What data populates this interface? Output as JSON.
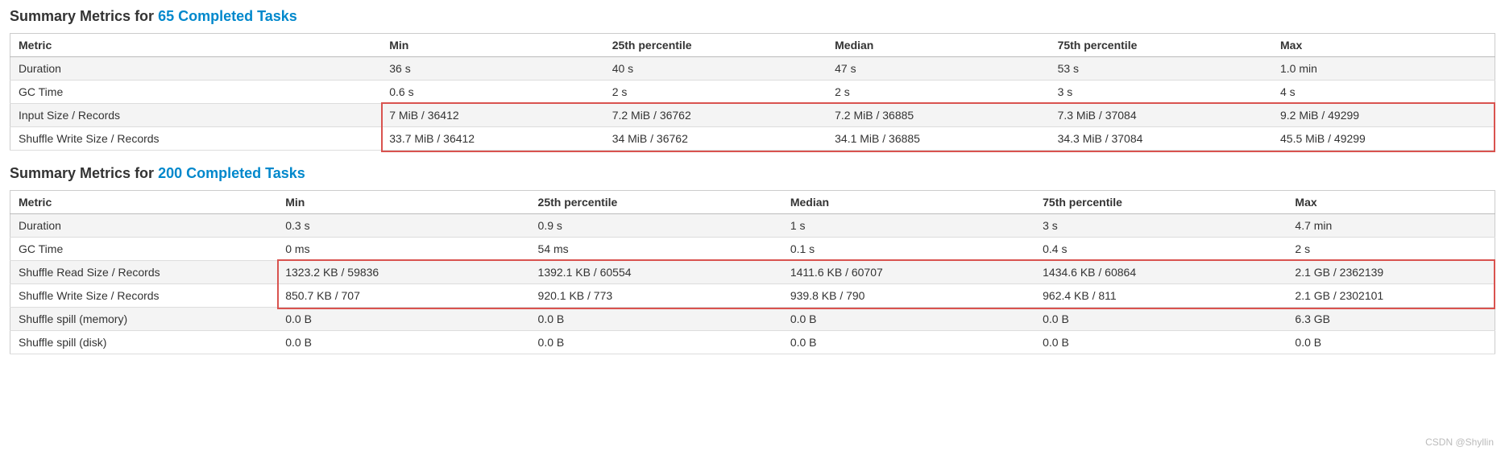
{
  "section1": {
    "title_prefix": "Summary Metrics for ",
    "task_count": "65 Completed Tasks",
    "columns": [
      "Metric",
      "Min",
      "25th percentile",
      "Median",
      "75th percentile",
      "Max"
    ],
    "rows": [
      {
        "metric": "Duration",
        "min": "36 s",
        "p25": "40 s",
        "median": "47 s",
        "p75": "53 s",
        "max": "1.0 min"
      },
      {
        "metric": "GC Time",
        "min": "0.6 s",
        "p25": "2 s",
        "median": "2 s",
        "p75": "3 s",
        "max": "4 s"
      },
      {
        "metric": "Input Size / Records",
        "min": "7 MiB / 36412",
        "p25": "7.2 MiB / 36762",
        "median": "7.2 MiB / 36885",
        "p75": "7.3 MiB / 37084",
        "max": "9.2 MiB / 49299"
      },
      {
        "metric": "Shuffle Write Size / Records",
        "min": "33.7 MiB / 36412",
        "p25": "34 MiB / 36762",
        "median": "34.1 MiB / 36885",
        "p75": "34.3 MiB / 37084",
        "max": "45.5 MiB / 49299"
      }
    ]
  },
  "section2": {
    "title_prefix": "Summary Metrics for ",
    "task_count": "200 Completed Tasks",
    "columns": [
      "Metric",
      "Min",
      "25th percentile",
      "Median",
      "75th percentile",
      "Max"
    ],
    "rows": [
      {
        "metric": "Duration",
        "min": "0.3 s",
        "p25": "0.9 s",
        "median": "1 s",
        "p75": "3 s",
        "max": "4.7 min"
      },
      {
        "metric": "GC Time",
        "min": "0 ms",
        "p25": "54 ms",
        "median": "0.1 s",
        "p75": "0.4 s",
        "max": "2 s"
      },
      {
        "metric": "Shuffle Read Size / Records",
        "min": "1323.2 KB / 59836",
        "p25": "1392.1 KB / 60554",
        "median": "1411.6 KB / 60707",
        "p75": "1434.6 KB / 60864",
        "max": "2.1 GB / 2362139"
      },
      {
        "metric": "Shuffle Write Size / Records",
        "min": "850.7 KB / 707",
        "p25": "920.1 KB / 773",
        "median": "939.8 KB / 790",
        "p75": "962.4 KB / 811",
        "max": "2.1 GB / 2302101"
      },
      {
        "metric": "Shuffle spill (memory)",
        "min": "0.0 B",
        "p25": "0.0 B",
        "median": "0.0 B",
        "p75": "0.0 B",
        "max": "6.3 GB"
      },
      {
        "metric": "Shuffle spill (disk)",
        "min": "0.0 B",
        "p25": "0.0 B",
        "median": "0.0 B",
        "p75": "0.0 B",
        "max": "0.0 B"
      }
    ]
  },
  "watermark": "CSDN @Shyllin"
}
